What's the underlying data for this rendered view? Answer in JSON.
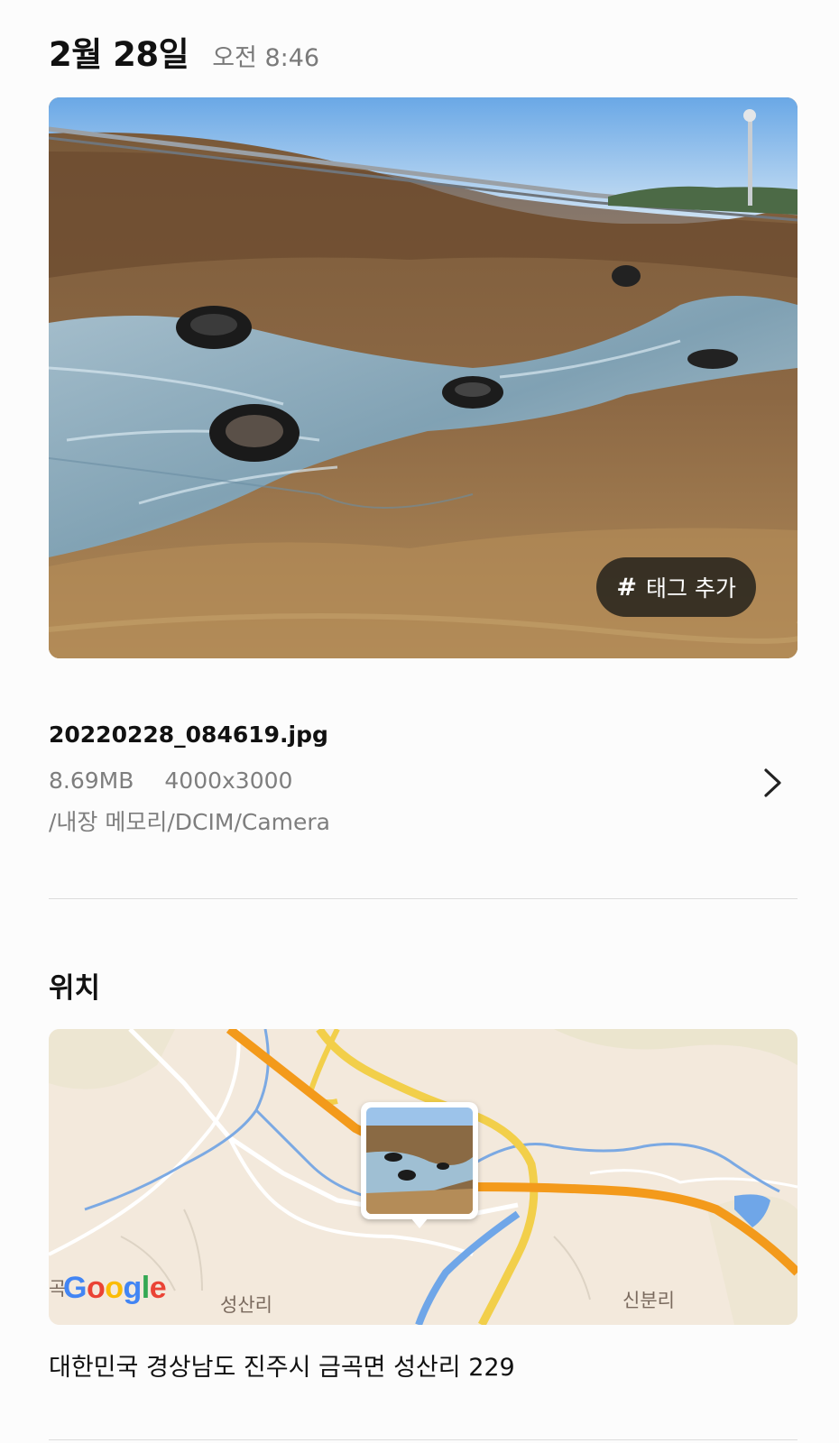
{
  "header": {
    "date": "2월 28일",
    "time": "오전 8:46"
  },
  "photo": {
    "tag_button_icon": "#",
    "tag_button_label": "태그 추가"
  },
  "file": {
    "name": "20220228_084619.jpg",
    "size": "8.69MB",
    "resolution": "4000x3000",
    "path": "/내장 메모리/DCIM/Camera",
    "chevron_icon": "chevron-right-icon"
  },
  "location": {
    "title": "위치",
    "map_labels": {
      "village_left": "성산리",
      "village_right": "신분리",
      "edge_label": "곡"
    },
    "map_attribution": "Google",
    "address": "대한민국 경상남도 진주시 금곡면 성산리 229"
  },
  "colors": {
    "map_background": "#f3e9dc",
    "highway": "#f39a1b",
    "road_yellow": "#f2cf4a",
    "river": "#6fa6e8",
    "google_blue": "#4285F4",
    "google_red": "#EA4335",
    "google_yellow": "#FBBC05",
    "google_green": "#34A853"
  }
}
